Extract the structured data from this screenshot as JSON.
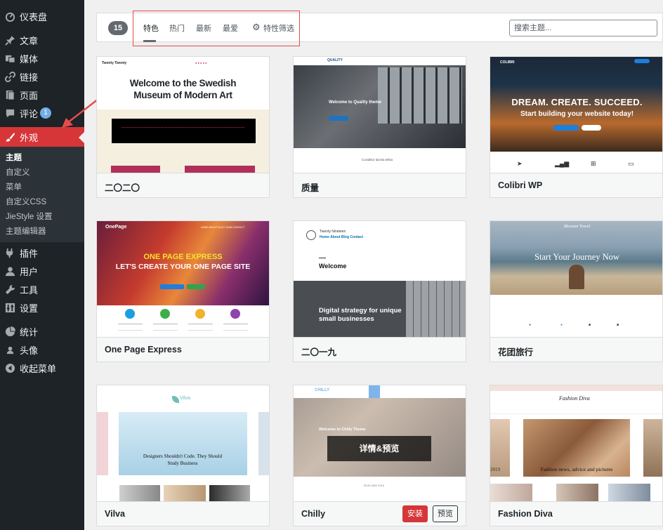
{
  "sidebar": {
    "items": [
      {
        "label": "仪表盘",
        "icon": "dashboard-icon"
      },
      {
        "label": "文章",
        "icon": "pin-icon"
      },
      {
        "label": "媒体",
        "icon": "media-icon"
      },
      {
        "label": "链接",
        "icon": "link-icon"
      },
      {
        "label": "页面",
        "icon": "page-icon"
      },
      {
        "label": "评论",
        "icon": "comment-icon",
        "badge": "1"
      },
      {
        "label": "外观",
        "icon": "brush-icon",
        "active": true
      },
      {
        "label": "插件",
        "icon": "plugin-icon"
      },
      {
        "label": "用户",
        "icon": "user-icon"
      },
      {
        "label": "工具",
        "icon": "wrench-icon"
      },
      {
        "label": "设置",
        "icon": "settings-icon"
      },
      {
        "label": "统计",
        "icon": "stats-icon"
      },
      {
        "label": "头像",
        "icon": "avatar-icon"
      },
      {
        "label": "收起菜单",
        "icon": "collapse-icon"
      }
    ],
    "submenu": [
      "主题",
      "自定义",
      "菜单",
      "自定义CSS",
      "JieStyle 设置",
      "主题编辑器"
    ]
  },
  "filter": {
    "count": "15",
    "tabs": [
      "特色",
      "热门",
      "最新",
      "最爱"
    ],
    "feature_filter": "特性筛选",
    "search_placeholder": "搜索主题..."
  },
  "themes": [
    {
      "name": "二〇二〇",
      "title": "Welcome to the Swedish Museum of Modern Art",
      "brand": "Twenty Twenty"
    },
    {
      "name": "质量",
      "title": "Welcome to Quality theme",
      "brand": "QUALITY",
      "caption": "Curabitur lacinia tellus"
    },
    {
      "name": "Colibri WP",
      "title": "DREAM. CREATE. SUCCEED.",
      "subtitle": "Start building your website today!",
      "brand": "COLIBRI"
    },
    {
      "name": "One Page Express",
      "title": "ONE PAGE EXPRESS",
      "subtitle": "LET'S CREATE YOUR ONE PAGE SITE",
      "brand": "OnePage"
    },
    {
      "name": "二〇一九",
      "title": "Welcome",
      "subtitle": "Digital strategy for unique small businesses",
      "brand": "Twenty Nineteen",
      "nav": "Home  About  Blog  Contact"
    },
    {
      "name": "花团旅行",
      "title": "Start Your Journey Now",
      "brand": "Blossom Travel"
    },
    {
      "name": "Vilva",
      "title": "Designers Shouldn't Code. They Should Study Business",
      "brand": "Vilva"
    },
    {
      "name": "Chilly",
      "title": "Welcome to Chilly Theme",
      "brand": "CHILLY",
      "caption": "Duis aute irure",
      "overlay": "详情&预览",
      "install": "安装",
      "preview": "预览"
    },
    {
      "name": "Fashion Diva",
      "title": "Fashion news, advice and pictures",
      "brand": "Fashion Diva",
      "side": "2019"
    }
  ],
  "colors": {
    "sidebar": "#1d2327",
    "active": "#d63638",
    "annotation": "#e34d4d"
  }
}
